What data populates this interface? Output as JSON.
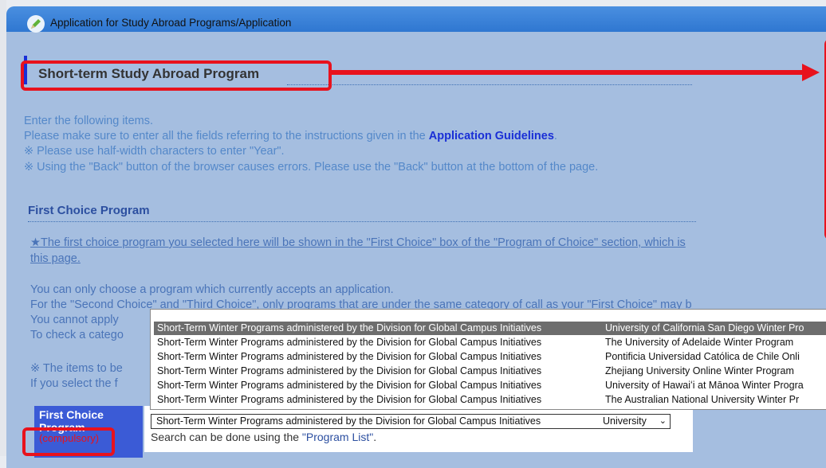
{
  "window": {
    "title": "Application for Study Abroad Programs/Application"
  },
  "page": {
    "heading": "Short-term Study Abroad Program",
    "instructions": {
      "line1": "Enter the following items.",
      "line2_pre": "Please make sure to enter all the fields referring to the instructions given in the ",
      "line2_bold": "Application Guidelines",
      "line2_post": ".",
      "line3": "※ Please use half-width characters to enter \"Year\".",
      "line4": "※ Using the \"Back\" button of the browser causes errors. Please use the \"Back\" button at the bottom of the page."
    },
    "first_choice": {
      "heading": "First Choice Program",
      "link_line1": "★The first choice program you selected here will be shown in the \"First Choice\" box of the \"Program of Choice\" section, which is",
      "link_line2": "this page.",
      "note1": "You can only choose a program which currently accepts an application.",
      "note2": "For the \"Second Choice\" and \"Third Choice\", only programs that are under the same category of call as your \"First Choice\" may b",
      "note3": "You cannot apply",
      "note4": "To check a catego",
      "note5": "※ The items to be",
      "note6": "If you select the f",
      "field_label": "First Choice Program",
      "compulsory": "(compulsory)",
      "select_category": "Short-Term Winter Programs administered by the Division for Global Campus Initiatives",
      "select_program": "University",
      "search_pre": "Search can be done using the ",
      "search_link": "\"Program List\"",
      "search_post": ".",
      "options": [
        {
          "category": "Short-Term Winter Programs administered by the Division for Global Campus Initiatives",
          "program": "University of California San Diego Winter Pro",
          "selected": true
        },
        {
          "category": "Short-Term Winter Programs administered by the Division for Global Campus Initiatives",
          "program": "The University of Adelaide Winter Program",
          "selected": false
        },
        {
          "category": "Short-Term Winter Programs administered by the Division for Global Campus Initiatives",
          "program": "Pontificia Universidad Católica de Chile Onli",
          "selected": false
        },
        {
          "category": "Short-Term Winter Programs administered by the Division for Global Campus Initiatives",
          "program": "Zhejiang University Online Winter Program",
          "selected": false
        },
        {
          "category": "Short-Term Winter Programs administered by the Division for Global Campus Initiatives",
          "program": "University of Hawaiʻi at Mānoa Winter Progra",
          "selected": false
        },
        {
          "category": "Short-Term Winter Programs administered by the Division for Global Campus Initiatives",
          "program": "The Australian National University Winter Pr",
          "selected": false
        }
      ]
    }
  },
  "colors": {
    "annotation": "#e8121d",
    "panel": "#a5bee0",
    "accent": "#1a2fd6"
  }
}
